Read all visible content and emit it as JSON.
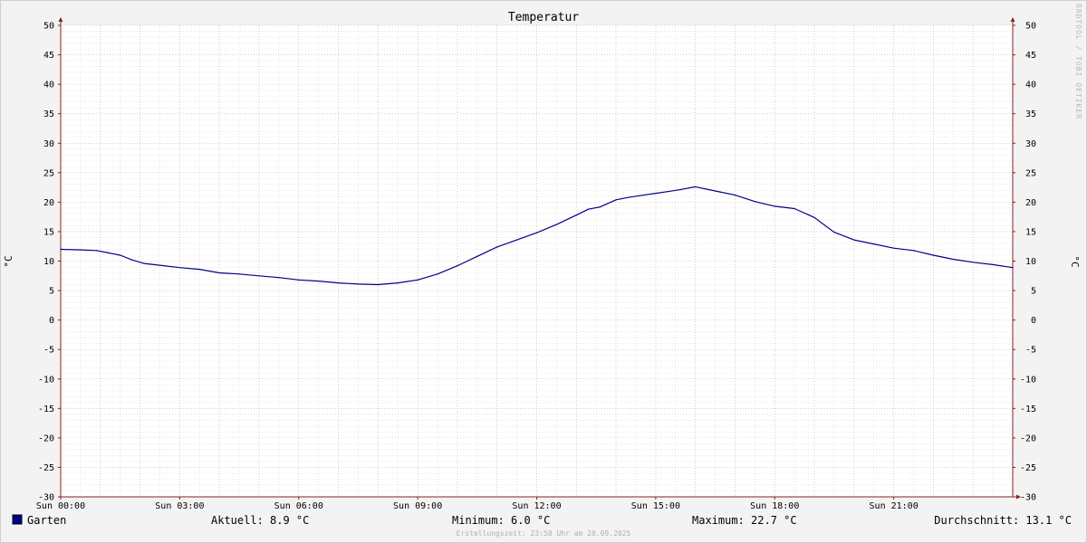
{
  "chart_data": {
    "type": "line",
    "title": "Temperatur",
    "xlabel": "",
    "ylabel": "°C",
    "ylabel_right": "°C",
    "ylim": [
      -30,
      50
    ],
    "yticks": [
      50,
      45,
      40,
      35,
      30,
      25,
      20,
      15,
      10,
      5,
      0,
      -5,
      -10,
      -15,
      -20,
      -25,
      -30
    ],
    "x_range_hours": [
      0,
      24
    ],
    "xticks": [
      {
        "hour": 0,
        "label": "Sun 00:00"
      },
      {
        "hour": 3,
        "label": "Sun 03:00"
      },
      {
        "hour": 6,
        "label": "Sun 06:00"
      },
      {
        "hour": 9,
        "label": "Sun 09:00"
      },
      {
        "hour": 12,
        "label": "Sun 12:00"
      },
      {
        "hour": 15,
        "label": "Sun 15:00"
      },
      {
        "hour": 18,
        "label": "Sun 18:00"
      },
      {
        "hour": 21,
        "label": "Sun 21:00"
      }
    ],
    "grid": true,
    "legend": "bottom-left",
    "series": [
      {
        "name": "Garten",
        "color": "#00008b",
        "x_hours": [
          0,
          0.5,
          0.9,
          1.2,
          1.5,
          1.8,
          2.1,
          2.5,
          3.0,
          3.5,
          4.0,
          4.5,
          5.0,
          5.5,
          6.0,
          6.5,
          7.0,
          7.5,
          8.0,
          8.5,
          9.0,
          9.5,
          10.0,
          10.5,
          11.0,
          11.5,
          12.0,
          12.5,
          13.0,
          13.3,
          13.6,
          14.0,
          14.3,
          14.6,
          15.0,
          15.3,
          15.6,
          16.0,
          16.5,
          17.0,
          17.5,
          18.0,
          18.5,
          19.0,
          19.5,
          20.0,
          20.5,
          21.0,
          21.5,
          22.0,
          22.5,
          23.0,
          23.5,
          24.0
        ],
        "values": [
          12.0,
          11.9,
          11.8,
          11.4,
          11.0,
          10.2,
          9.6,
          9.3,
          8.9,
          8.6,
          8.0,
          7.8,
          7.5,
          7.2,
          6.8,
          6.6,
          6.3,
          6.1,
          6.0,
          6.3,
          6.8,
          7.8,
          9.2,
          10.8,
          12.4,
          13.6,
          14.8,
          16.2,
          17.8,
          18.8,
          19.2,
          20.4,
          20.8,
          21.1,
          21.5,
          21.8,
          22.1,
          22.6,
          21.9,
          21.2,
          20.1,
          19.3,
          18.9,
          17.4,
          14.9,
          13.6,
          12.9,
          12.2,
          11.8,
          11.0,
          10.3,
          9.8,
          9.4,
          8.9
        ]
      }
    ]
  },
  "footer": {
    "legend_label": "Garten",
    "legend_color": "#00008b",
    "current": "Aktuell: 8.9 °C",
    "minimum": "Minimum: 6.0 °C",
    "maximum": "Maximum: 22.7 °C",
    "average": "Durchschnitt: 13.1 °C",
    "created": "Erstellungszeit: 23:58 Uhr am 28.09.2025"
  },
  "watermark": "RRDTOOL / TOBI OETIKER",
  "colors": {
    "background": "#f3f3f3",
    "plot_bg": "#ffffff",
    "major_grid": "#e8a0a0",
    "minor_grid": "#d8d8d8",
    "axis": "#8b2020",
    "line": "#00008b"
  }
}
